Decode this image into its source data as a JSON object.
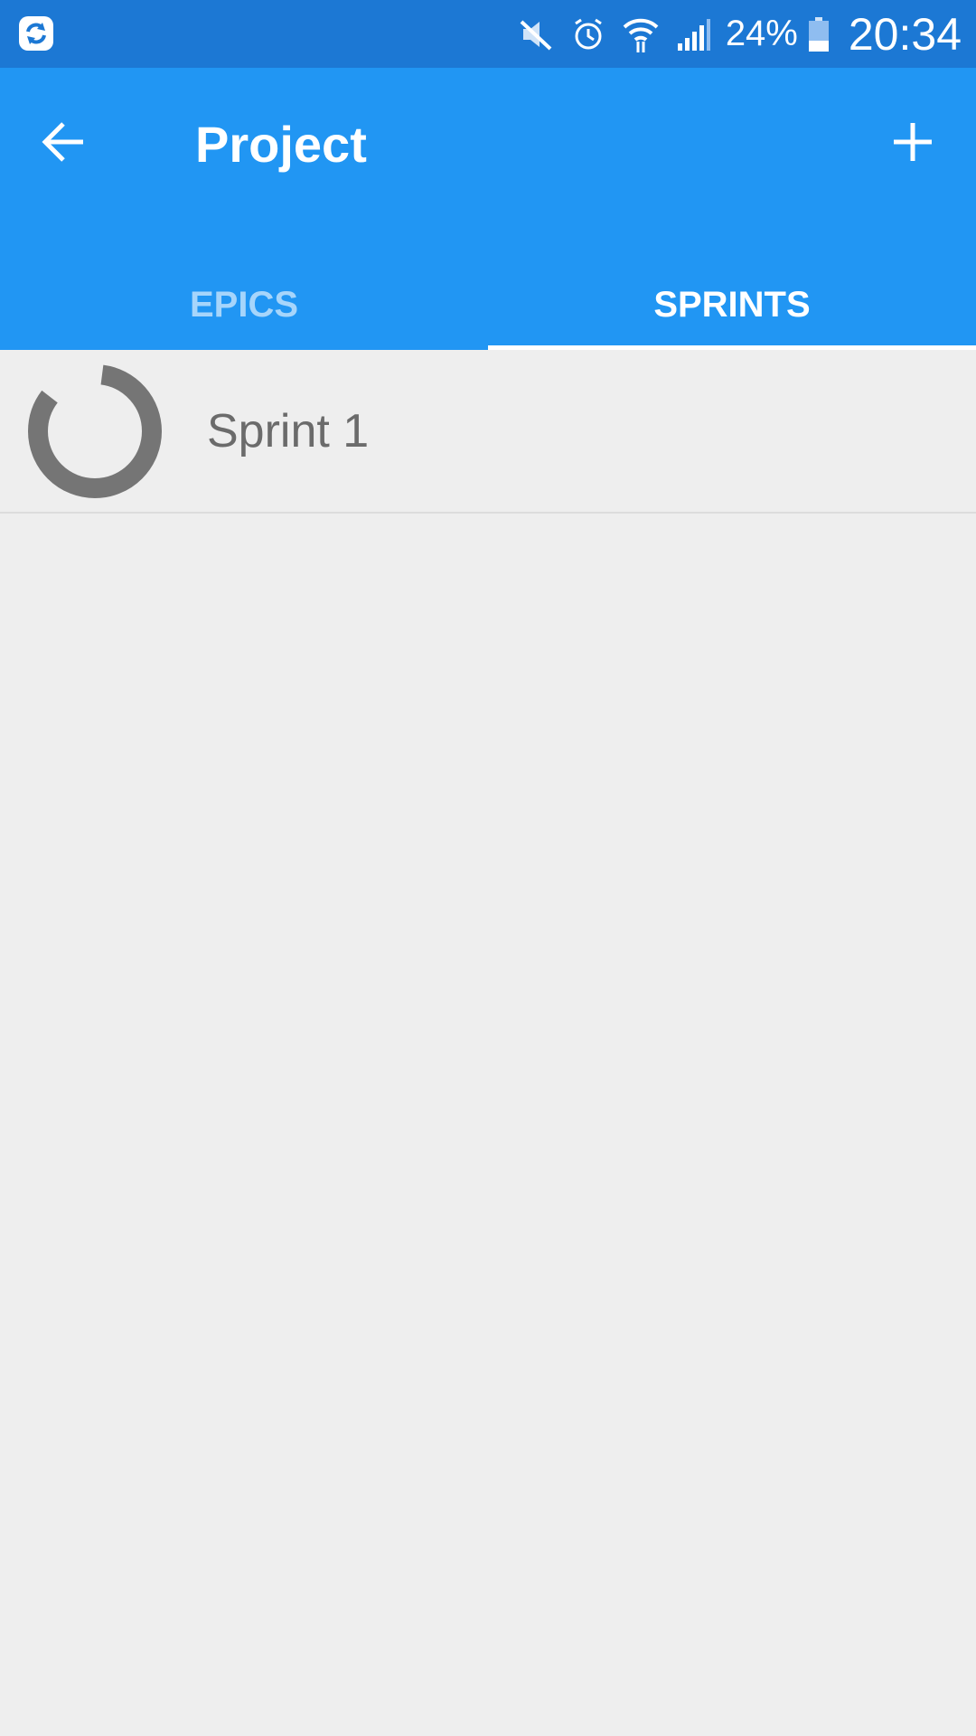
{
  "status_bar": {
    "battery_percent": "24%",
    "time": "20:34",
    "icons": [
      "sync-app-icon",
      "mute-icon",
      "alarm-icon",
      "wifi-icon",
      "signal-icon",
      "battery-icon"
    ]
  },
  "app_bar": {
    "title": "Project",
    "back_icon": "arrow-back-icon",
    "add_icon": "plus-icon",
    "color": "#2196f3"
  },
  "tabs": [
    {
      "label": "EPICS",
      "active": false
    },
    {
      "label": "SPRINTS",
      "active": true
    }
  ],
  "sprints": [
    {
      "name": "Sprint 1",
      "progress_icon": "progress-ring-icon"
    }
  ]
}
